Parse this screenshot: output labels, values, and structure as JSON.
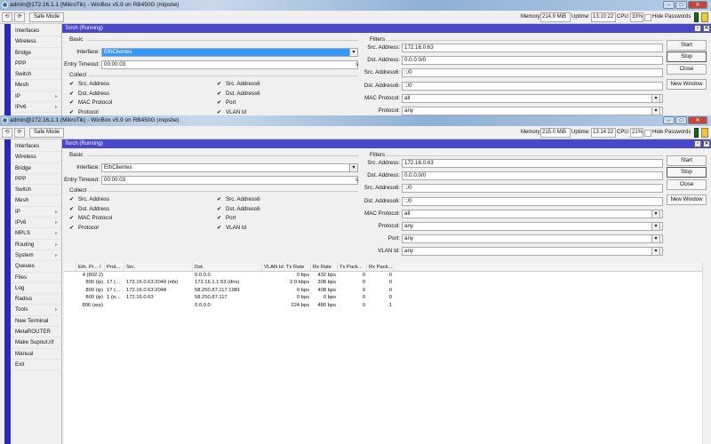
{
  "windows": [
    {
      "title": "admin@172.16.1.1 (MikroTik) - WinBox v5.9 on RB450G (mipsbe)",
      "toolbar": {
        "undo": "⟲",
        "redo": "⟳",
        "safe_mode": "Safe Mode",
        "memory_label": "Memory:",
        "memory": "214.9 MiB",
        "uptime_label": "Uptime:",
        "uptime": "13:10:22",
        "cpu_label": "CPU:",
        "cpu": "33%",
        "hide_passwords": "Hide Passwords"
      },
      "menu": [
        {
          "label": "Interfaces"
        },
        {
          "label": "Wireless"
        },
        {
          "label": "Bridge"
        },
        {
          "label": "PPP"
        },
        {
          "label": "Switch"
        },
        {
          "label": "Mesh"
        },
        {
          "label": "IP",
          "arrow": true
        },
        {
          "label": "IPv6",
          "arrow": true
        }
      ],
      "torch": {
        "title": "Torch (Running)",
        "basic": "Basic",
        "interface_label": "Interface:",
        "interface": "EthClientes",
        "interface_selected": true,
        "timeout_label": "Entry Timeout:",
        "timeout": "00:00:03",
        "timeout_unit": "s",
        "collect": "Collect",
        "collect_left": [
          {
            "label": "Src. Address",
            "checked": true
          },
          {
            "label": "Dst. Address",
            "checked": true
          },
          {
            "label": "MAC Protocol",
            "checked": true
          },
          {
            "label": "Protocol",
            "checked": true
          }
        ],
        "collect_right": [
          {
            "label": "Src. Address6",
            "checked": true
          },
          {
            "label": "Dst. Address6",
            "checked": true
          },
          {
            "label": "Port",
            "checked": true
          },
          {
            "label": "VLAN Id",
            "checked": true
          }
        ],
        "filters": "Filters",
        "filter_rows": [
          {
            "label": "Src. Address:",
            "value": "172.16.0.63"
          },
          {
            "label": "Dst. Address:",
            "value": "0.0.0.0/0"
          },
          {
            "label": "Src. Address6:",
            "value": "::/0"
          },
          {
            "label": "Dst. Address6:",
            "value": "::/0"
          },
          {
            "label": "MAC Protocol:",
            "value": "all",
            "dropdown": true
          },
          {
            "label": "Protocol:",
            "value": "any",
            "dropdown": true
          }
        ],
        "buttons": [
          "Start",
          "Stop",
          "Close",
          "New Window"
        ]
      }
    },
    {
      "title": "admin@172.16.1.1 (MikroTik) - WinBox v5.9 on RB450G (mipsbe)",
      "toolbar": {
        "undo": "⟲",
        "redo": "⟳",
        "safe_mode": "Safe Mode",
        "memory_label": "Memory:",
        "memory": "215.0 MiB",
        "uptime_label": "Uptime:",
        "uptime": "13:14:22",
        "cpu_label": "CPU:",
        "cpu": "21%",
        "hide_passwords": "Hide Passwords"
      },
      "menu": [
        {
          "label": "Interfaces"
        },
        {
          "label": "Wireless"
        },
        {
          "label": "Bridge"
        },
        {
          "label": "PPP"
        },
        {
          "label": "Switch"
        },
        {
          "label": "Mesh"
        },
        {
          "label": "IP",
          "arrow": true
        },
        {
          "label": "IPv6",
          "arrow": true
        },
        {
          "label": "MPLS",
          "arrow": true
        },
        {
          "label": "Routing",
          "arrow": true
        },
        {
          "label": "System",
          "arrow": true
        },
        {
          "label": "Queues"
        },
        {
          "label": "Files"
        },
        {
          "label": "Log"
        },
        {
          "label": "Radius"
        },
        {
          "label": "Tools",
          "arrow": true
        },
        {
          "label": "New Terminal"
        },
        {
          "label": "MetaROUTER"
        },
        {
          "label": "Make Supout.rif"
        },
        {
          "label": "Manual"
        },
        {
          "label": "Exit"
        }
      ],
      "torch": {
        "title": "Torch (Running)",
        "basic": "Basic",
        "interface_label": "Interface:",
        "interface": "EthClientes",
        "interface_selected": false,
        "timeout_label": "Entry Timeout:",
        "timeout": "00:00:03",
        "timeout_unit": "s",
        "collect": "Collect",
        "collect_left": [
          {
            "label": "Src. Address",
            "checked": true
          },
          {
            "label": "Dst. Address",
            "checked": true
          },
          {
            "label": "MAC Protocol",
            "checked": true
          },
          {
            "label": "Protocol",
            "checked": true
          }
        ],
        "collect_right": [
          {
            "label": "Src. Address6",
            "checked": true
          },
          {
            "label": "Dst. Address6",
            "checked": true
          },
          {
            "label": "Port",
            "checked": true
          },
          {
            "label": "VLAN Id",
            "checked": true
          }
        ],
        "filters": "Filters",
        "filter_rows": [
          {
            "label": "Src. Address:",
            "value": "172.16.0.63"
          },
          {
            "label": "Dst. Address:",
            "value": "0.0.0.0/0"
          },
          {
            "label": "Src. Address6:",
            "value": "::/0"
          },
          {
            "label": "Dst. Address6:",
            "value": "::/0"
          },
          {
            "label": "MAC Protocol:",
            "value": "all",
            "dropdown": true
          },
          {
            "label": "Protocol:",
            "value": "any",
            "dropdown": true
          },
          {
            "label": "Port:",
            "value": "any",
            "dropdown": true
          },
          {
            "label": "VLAN Id:",
            "value": "any",
            "dropdown": true
          }
        ],
        "buttons": [
          "Start",
          "Stop",
          "Close",
          "New Window"
        ],
        "table": {
          "columns": [
            "",
            "Eth. Pr... /",
            "Prot...",
            "Src.",
            "Dst.",
            "VLAN Id",
            "Tx Rate",
            "Rx Rate",
            "Tx Pack...",
            "Rx Pack..."
          ],
          "rows": [
            [
              "",
              "4 (802.2)",
              "",
              "",
              "0.0.0.0",
              "",
              "0 bps",
              "432 bps",
              "0",
              "0"
            ],
            [
              "",
              "800 (ip)",
              "17 (...",
              "172.16.0.63:2049 (nfs)",
              "172.16.1.1:53 (dns)",
              "",
              "2.0 kbps",
              "308 bps",
              "0",
              "0"
            ],
            [
              "",
              "800 (ip)",
              "17 (...",
              "172.16.0.63:2048",
              "58.250.87.117:1981",
              "",
              "0 bps",
              "408 bps",
              "0",
              "0"
            ],
            [
              "",
              "800 (ip)",
              "1 (ic...",
              "172.16.0.63",
              "58.250.87.117",
              "",
              "0 bps",
              "0 bps",
              "0",
              "0"
            ],
            [
              "",
              "806 (arp)",
              "",
              "",
              "0.0.0.0",
              "",
              "224 bps",
              "480 bps",
              "0",
              "1"
            ]
          ]
        }
      }
    }
  ]
}
